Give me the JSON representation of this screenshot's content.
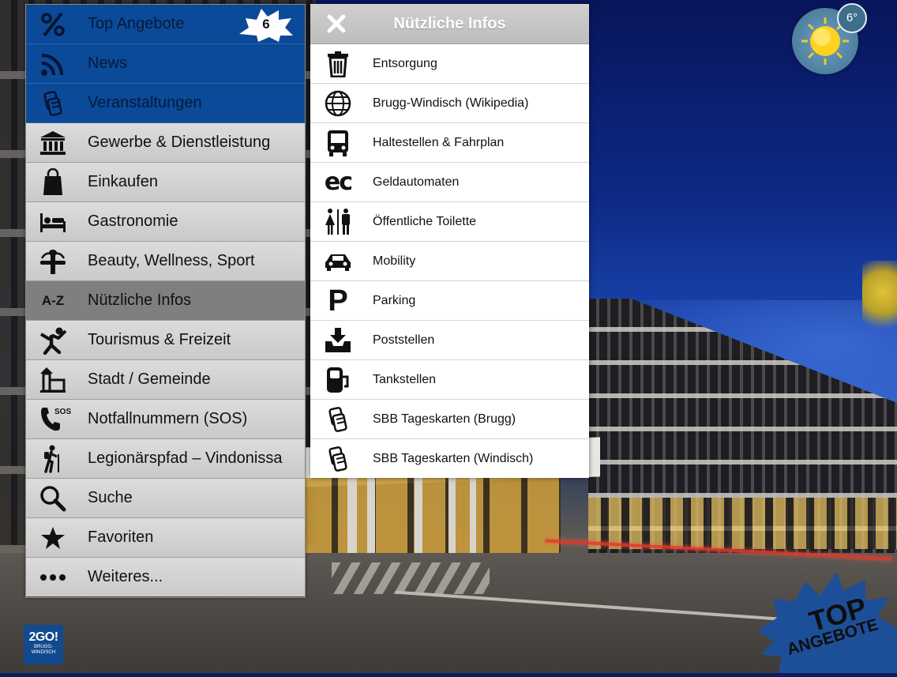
{
  "menu": {
    "items": [
      {
        "label": "Top Angebote",
        "icon": "percent-icon",
        "badge": "6"
      },
      {
        "label": "News",
        "icon": "rss-icon"
      },
      {
        "label": "Veranstaltungen",
        "icon": "tickets-icon"
      },
      {
        "label": "Gewerbe & Dienstleistung",
        "icon": "bank-icon"
      },
      {
        "label": "Einkaufen",
        "icon": "shopping-bag-icon"
      },
      {
        "label": "Gastronomie",
        "icon": "bed-icon"
      },
      {
        "label": "Beauty, Wellness, Sport",
        "icon": "fountain-icon"
      },
      {
        "label": "Nützliche Infos",
        "icon": "a-z-icon",
        "icon_text": "A-Z"
      },
      {
        "label": "Tourismus & Freizeit",
        "icon": "person-jumping-icon"
      },
      {
        "label": "Stadt / Gemeinde",
        "icon": "building-icon"
      },
      {
        "label": "Notfallnummern (SOS)",
        "icon": "phone-sos-icon",
        "icon_text": "SOS"
      },
      {
        "label": "Legionärspfad – Vindonissa",
        "icon": "hiker-icon"
      },
      {
        "label": "Suche",
        "icon": "search-icon"
      },
      {
        "label": "Favoriten",
        "icon": "star-icon"
      },
      {
        "label": "Weiteres...",
        "icon": "more-dots-icon"
      }
    ]
  },
  "submenu": {
    "title": "Nützliche Infos",
    "items": [
      {
        "label": "Entsorgung",
        "icon": "trash-icon"
      },
      {
        "label": "Brugg-Windisch (Wikipedia)",
        "icon": "globe-icon"
      },
      {
        "label": "Haltestellen & Fahrplan",
        "icon": "bus-icon"
      },
      {
        "label": "Geldautomaten",
        "icon": "ec-icon",
        "icon_text": "ec"
      },
      {
        "label": "Öffentliche Toilette",
        "icon": "toilet-icon"
      },
      {
        "label": "Mobility",
        "icon": "car-icon"
      },
      {
        "label": "Parking",
        "icon": "parking-icon",
        "icon_text": "P"
      },
      {
        "label": "Poststellen",
        "icon": "mail-tray-icon"
      },
      {
        "label": "Tankstellen",
        "icon": "fuel-icon"
      },
      {
        "label": "SBB Tageskarten (Brugg)",
        "icon": "tickets-icon"
      },
      {
        "label": "SBB Tageskarten (Windisch)",
        "icon": "tickets-icon"
      }
    ]
  },
  "weather": {
    "temperature": "6°",
    "icon": "sun-icon"
  },
  "logo": {
    "main": "2GO!",
    "sub1": "BRUGG-",
    "sub2": "WINDISCH"
  },
  "promo": {
    "line1": "TOP",
    "line2": "ANGEBOTE"
  },
  "colors": {
    "menu_blue": "#0b4a98",
    "menu_gray": "#d2d2d2",
    "menu_active": "#7f7f7f",
    "promo_blue": "#1d4f99"
  }
}
